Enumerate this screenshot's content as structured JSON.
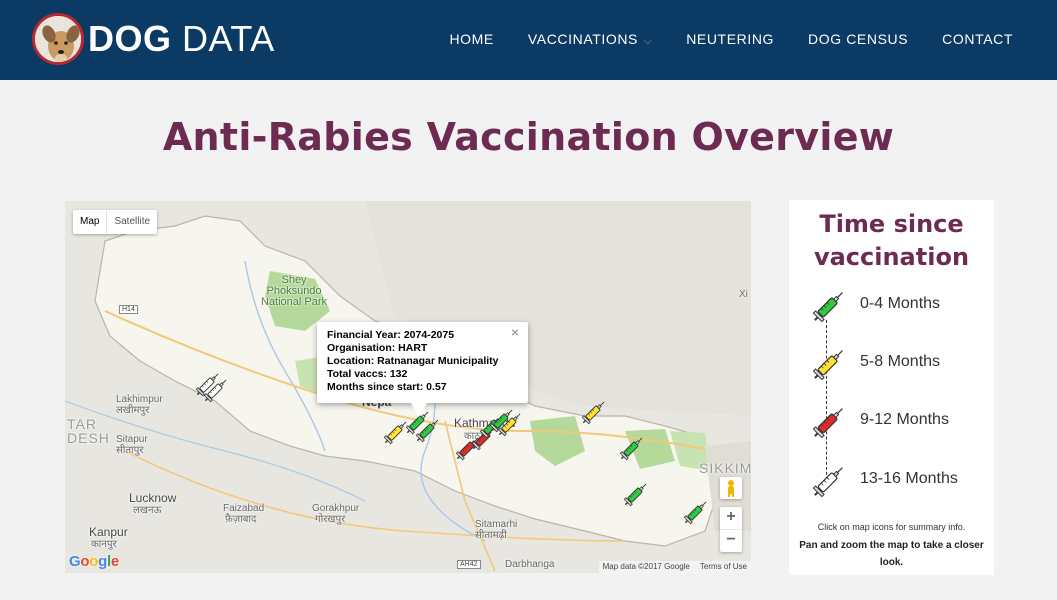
{
  "header": {
    "brand_bold": "DOG",
    "brand_light": "DATA",
    "nav": [
      {
        "label": "HOME"
      },
      {
        "label": "VACCINATIONS",
        "caret": "⌵"
      },
      {
        "label": "NEUTERING"
      },
      {
        "label": "DOG CENSUS"
      },
      {
        "label": "CONTACT"
      }
    ]
  },
  "page_title": "Anti-Rabies Vaccination Overview",
  "map": {
    "type_controls": [
      "Map",
      "Satellite"
    ],
    "places": {
      "shey": "Shey\nPhoksundo\nNational Park",
      "lakhimpur": "Lakhimpur",
      "lakhimpur_dev": "लखीमपुर",
      "sitapur": "Sitapur",
      "sitapur_dev": "सीतापुर",
      "lucknow": "Lucknow",
      "lucknow_dev": "लखनऊ",
      "kanpur": "Kanpur",
      "kanpur_dev": "कानपुर",
      "faizabad": "Faizabad",
      "faizabad_dev": "फ़ैज़ाबाद",
      "gorakhpur": "Gorakhpur",
      "gorakhpur_dev": "गोरखपुर",
      "kathmandu": "Kathmandu",
      "kathmandu_dev": "काठमा",
      "sitamarhi": "Sitamarhi",
      "sitamarhi_dev": "सीतामढ़ी",
      "darbhanga": "Darbhanga",
      "sikkim": "SIKKIM",
      "tar": "TAR",
      "desh": "DESH",
      "nepal_partial": "Nepa",
      "xi": "Xi"
    },
    "highways": [
      "H14",
      "AH42"
    ],
    "infowindow": {
      "financial_year": "Financial Year: 2074-2075",
      "organisation": "Organisation: HART",
      "location": "Location: Ratnanagar Municipality",
      "total_vaccs": "Total vaccs: 132",
      "months_since_start": "Months since start: 0.57",
      "close": "×"
    },
    "zoom_in": "+",
    "zoom_out": "−",
    "attribution": "Map data ©2017 Google",
    "terms": "Terms of Use",
    "google_logo": [
      "G",
      "o",
      "o",
      "g",
      "l",
      "e"
    ],
    "marker_colors": {
      "green": "#2ecc40",
      "yellow": "#ffe135",
      "red": "#e02b2b",
      "grey": "#ffffff"
    }
  },
  "legend": {
    "title": "Time since vaccination",
    "items": [
      {
        "label": "0-4 Months",
        "color": "#2ecc40"
      },
      {
        "label": "5-8 Months",
        "color": "#ffe135"
      },
      {
        "label": "9-12 Months",
        "color": "#e02b2b"
      },
      {
        "label": "13-16 Months",
        "color": "#ffffff"
      }
    ],
    "hint": "Click on map icons for summary info.",
    "hint_bold": "Pan and zoom the map to take a closer look."
  }
}
